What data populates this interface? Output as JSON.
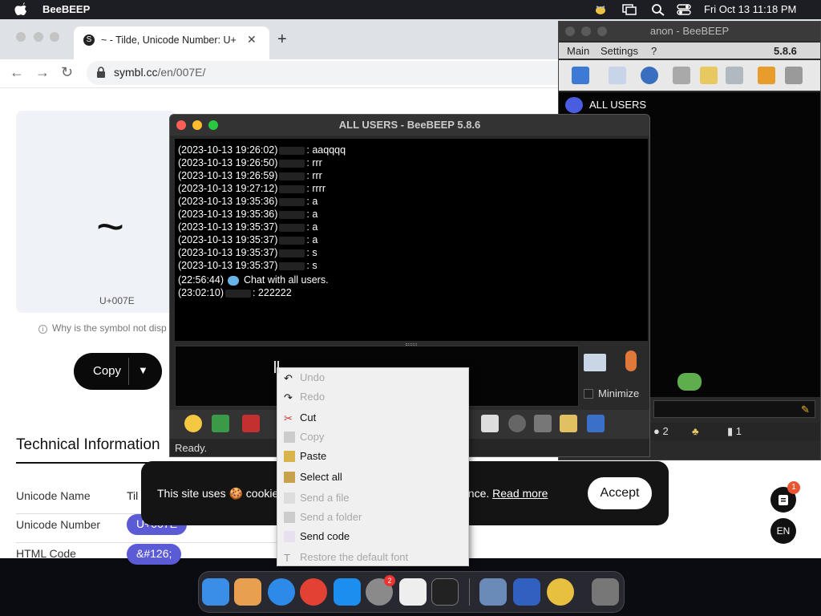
{
  "menubar": {
    "app_name": "BeeBEEP",
    "clock": "Fri Oct 13  11:18 PM"
  },
  "browser": {
    "tab_title": "~ - Tilde, Unicode Number: U+",
    "tab_favicon": "S",
    "url_host": "symbl.cc",
    "url_path": "/en/007E/"
  },
  "page": {
    "glyph": "~",
    "code": "U+007E",
    "why_text": "Why is the symbol not disp",
    "copy_label": "Copy",
    "tech_heading": "Technical Information",
    "rows": [
      {
        "label": "Unicode Name",
        "value": "Til"
      },
      {
        "label": "Unicode Number",
        "value": "U+007E"
      },
      {
        "label": "HTML Code",
        "value": "&#126;"
      }
    ],
    "cookie_text_a": "This site uses 🍪 cookies",
    "cookie_text_b": "ence.",
    "cookie_more": "Read more",
    "cookie_accept": "Accept",
    "badge_count": "1",
    "lang": "EN"
  },
  "beebeep_main": {
    "title": "anon - BeeBEEP",
    "menu_main": "Main",
    "menu_settings": "Settings",
    "menu_help": "?",
    "version": "5.8.6",
    "all_users": "ALL USERS",
    "status_count_a": "2",
    "status_count_b": "1"
  },
  "chat": {
    "title": "ALL USERS - BeeBEEP 5.8.6",
    "log": [
      {
        "ts": "(2023-10-13 19:26:02)",
        "msg": ": aaqqqq"
      },
      {
        "ts": "(2023-10-13 19:26:50)",
        "msg": ": rrr"
      },
      {
        "ts": "(2023-10-13 19:26:59)",
        "msg": ": rrr"
      },
      {
        "ts": "(2023-10-13 19:27:12)",
        "msg": ": rrrr"
      },
      {
        "ts": "(2023-10-13 19:35:36)",
        "msg": ": a"
      },
      {
        "ts": "(2023-10-13 19:35:36)",
        "msg": ": a"
      },
      {
        "ts": "(2023-10-13 19:35:37)",
        "msg": ": a"
      },
      {
        "ts": "(2023-10-13 19:35:37)",
        "msg": ": a"
      },
      {
        "ts": "(2023-10-13 19:35:37)",
        "msg": ": s"
      },
      {
        "ts": "(2023-10-13 19:35:37)",
        "msg": ": s"
      }
    ],
    "sys_ts": "(22:56:44)",
    "sys_msg": "Chat with all users.",
    "last_ts": "(23:02:10)",
    "last_msg": ": 222222",
    "minimize_label": "Minimize",
    "status": "Ready."
  },
  "context_menu": {
    "items": [
      {
        "label": "Undo",
        "enabled": false,
        "icon": "undo-icon"
      },
      {
        "label": "Redo",
        "enabled": false,
        "icon": "redo-icon"
      },
      {
        "label": "Cut",
        "enabled": true,
        "icon": "scissors-icon"
      },
      {
        "label": "Copy",
        "enabled": false,
        "icon": "copy-icon"
      },
      {
        "label": "Paste",
        "enabled": true,
        "icon": "clipboard-icon"
      },
      {
        "label": "Select all",
        "enabled": true,
        "icon": "select-all-icon"
      },
      {
        "label": "Send a file",
        "enabled": false,
        "icon": "file-icon"
      },
      {
        "label": "Send a folder",
        "enabled": false,
        "icon": "folder-icon"
      },
      {
        "label": "Send code",
        "enabled": true,
        "icon": "code-icon"
      },
      {
        "label": "Restore the default font",
        "enabled": false,
        "icon": "font-icon"
      }
    ]
  },
  "dock": {
    "settings_badge": "2"
  }
}
